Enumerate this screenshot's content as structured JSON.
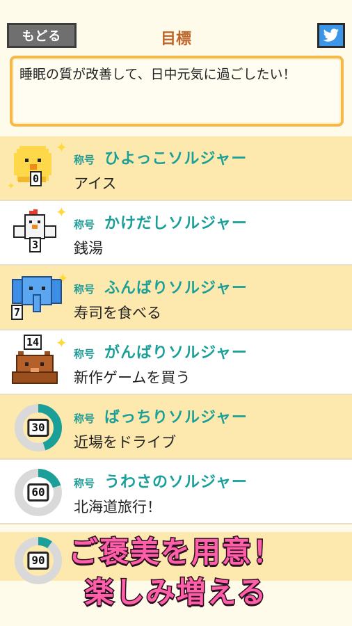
{
  "header": {
    "back_label": "もどる",
    "title": "目標",
    "share_icon": "twitter-bird-icon"
  },
  "goal_text": "睡眠の質が改善して、日中元気に過ごしたい！",
  "rank_prefix": "称号",
  "rows": [
    {
      "name": "ひよっこソルジャー",
      "reward": "アイス",
      "level": "0",
      "avatar": "chick-icon"
    },
    {
      "name": "かけだしソルジャー",
      "reward": "銭湯",
      "level": "3",
      "avatar": "rooster-icon"
    },
    {
      "name": "ふんばりソルジャー",
      "reward": "寿司を食べる",
      "level": "7",
      "avatar": "elephant-icon"
    },
    {
      "name": "がんばりソルジャー",
      "reward": "新作ゲームを買う",
      "level": "14",
      "avatar": "bear-icon"
    },
    {
      "name": "ばっちりソルジャー",
      "reward": "近場をドライブ",
      "level": "30",
      "progress": 0.45
    },
    {
      "name": "うわさのソルジャー",
      "reward": "北海道旅行！",
      "level": "60",
      "progress": 0.2
    },
    {
      "name": "",
      "reward": "",
      "level": "90",
      "progress": 0.1
    }
  ],
  "promo": {
    "line1": "ご褒美を用意！",
    "line2": "楽しみ増える"
  },
  "colors": {
    "accent": "#1aa098",
    "title": "#c0662b",
    "row_yellow": "#fde8ae",
    "goal_border": "#f5b84a",
    "promo_pink": "#ff5fa8"
  }
}
